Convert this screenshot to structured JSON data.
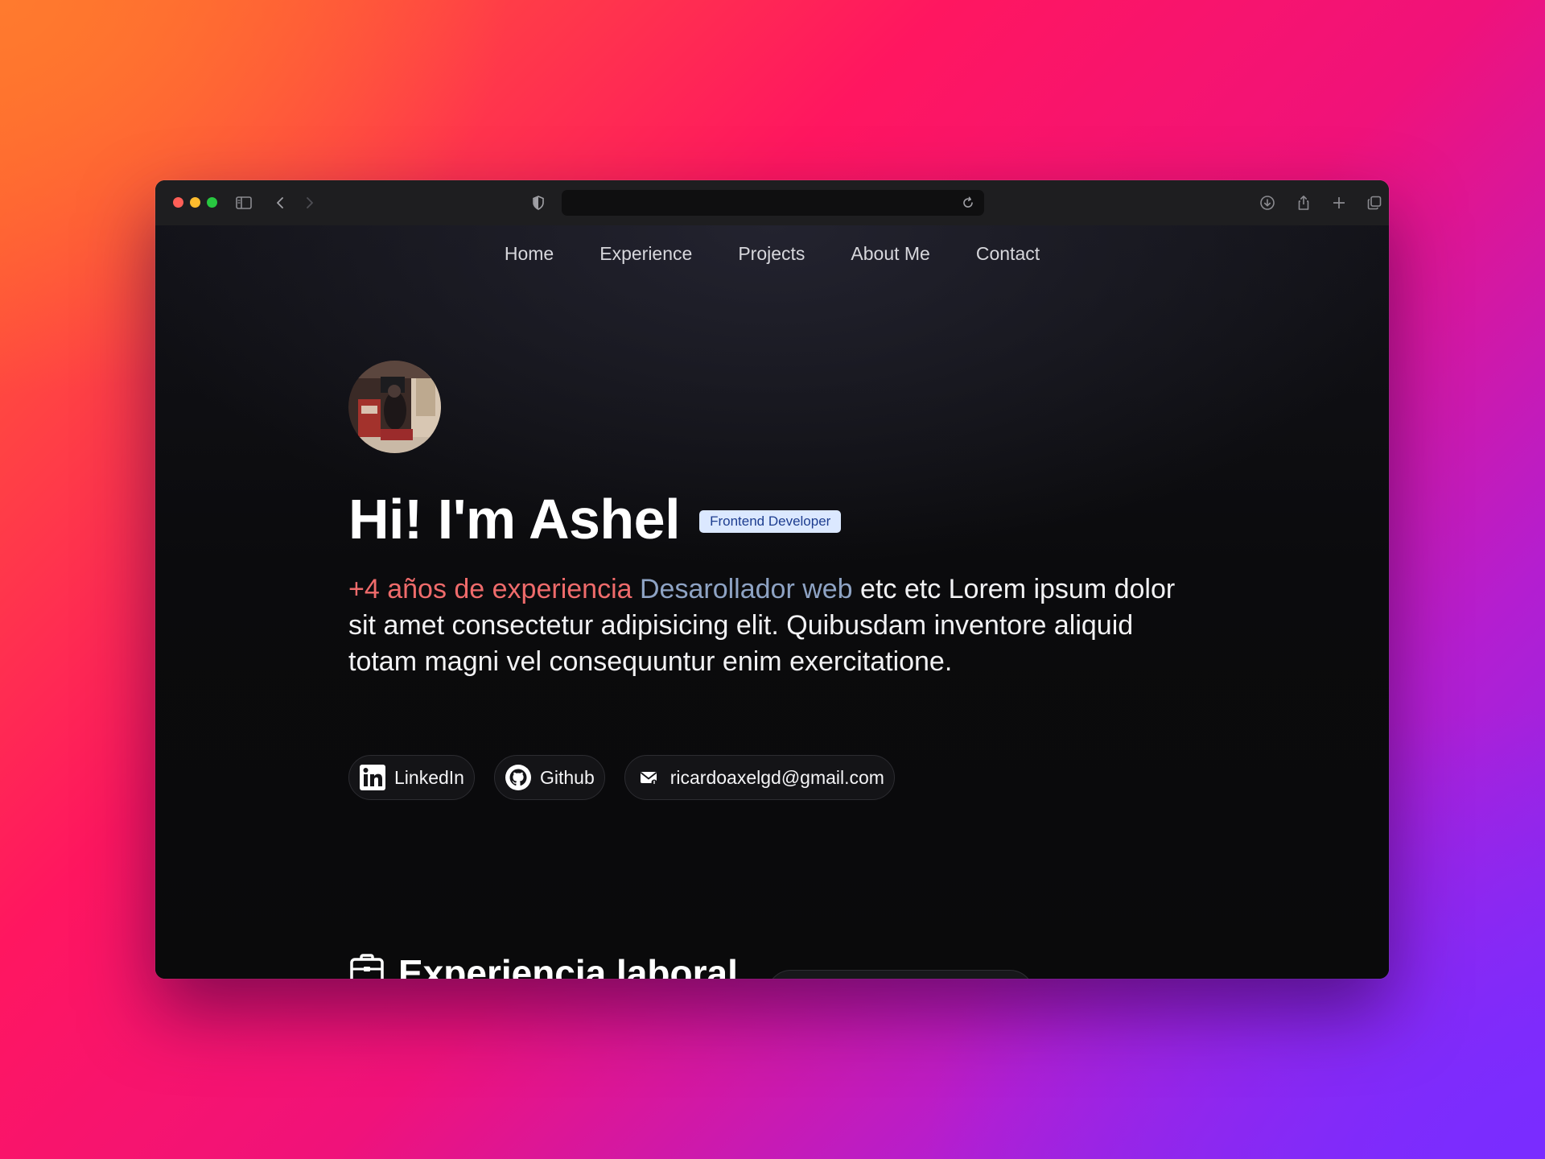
{
  "browser": {
    "traffic_lights": [
      "#ff5f57",
      "#febc2e",
      "#28c840"
    ],
    "icons": [
      "sidebar-icon",
      "back-icon",
      "forward-icon",
      "shield-icon",
      "reload-icon",
      "download-icon",
      "share-icon",
      "new-tab-icon",
      "tabs-overview-icon"
    ]
  },
  "nav": {
    "items": [
      "Home",
      "Experience",
      "Projects",
      "About Me",
      "Contact"
    ]
  },
  "hero": {
    "title": "Hi! I'm Ashel",
    "badge": "Frontend Developer",
    "bio": {
      "highlight_experience": "+4 años de experiencia",
      "highlight_role": "Desarollador web",
      "rest": "etc etc Lorem ipsum dolor sit amet consectetur adipisicing elit. Quibusdam inventore aliquid totam magni vel consequuntur enim exercitatione."
    }
  },
  "links": {
    "linkedin": "LinkedIn",
    "github": "Github",
    "email": "ricardoaxelgd@gmail.com"
  },
  "section": {
    "title": "Experiencia laboral"
  },
  "colors": {
    "accent_experience": "#ef6b6b",
    "accent_role": "#8ea3c4",
    "badge_bg": "#dbe8ff",
    "badge_text": "#1d3d8f"
  }
}
